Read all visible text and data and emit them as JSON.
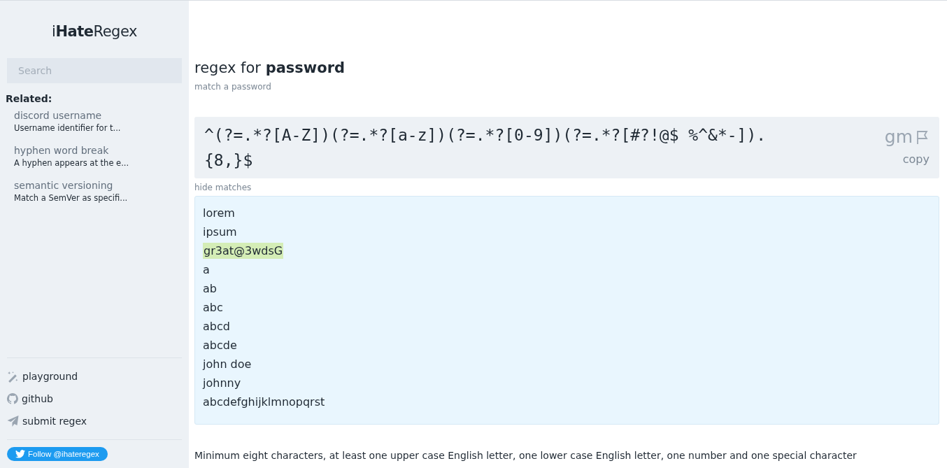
{
  "logo": {
    "prefix": "i",
    "bold": "Hate",
    "suffix": "Regex"
  },
  "search": {
    "placeholder": "Search"
  },
  "related": {
    "heading": "Related:",
    "items": [
      {
        "title": "discord username",
        "description": "Username identifier for t..."
      },
      {
        "title": "hyphen word break",
        "description": "A hyphen appears at the e..."
      },
      {
        "title": "semantic versioning",
        "description": "Match a SemVer as specifi..."
      }
    ]
  },
  "links": [
    {
      "kind": "playground",
      "label": "playground"
    },
    {
      "kind": "github",
      "label": "github"
    },
    {
      "kind": "submit",
      "label": "submit regex"
    }
  ],
  "follow_button": "Follow @ihateregex",
  "title": {
    "prefix": "regex for ",
    "subject": "password"
  },
  "subtitle": "match a password",
  "regex": {
    "pattern": "^(?=.*?[A-Z])(?=.*?[a-z])(?=.*?[0-9])(?=.*?[#?!@$ %^&*-]).{8,}$",
    "flags": "gm",
    "copy": "copy"
  },
  "toggle_matches": "hide matches",
  "samples": [
    {
      "text": "lorem",
      "matched": false
    },
    {
      "text": "ipsum",
      "matched": false
    },
    {
      "text": "gr3at@3wdsG",
      "matched": true
    },
    {
      "text": "a",
      "matched": false
    },
    {
      "text": "ab",
      "matched": false
    },
    {
      "text": "abc",
      "matched": false
    },
    {
      "text": "abcd",
      "matched": false
    },
    {
      "text": "abcde",
      "matched": false
    },
    {
      "text": "john doe",
      "matched": false
    },
    {
      "text": "johnny",
      "matched": false
    },
    {
      "text": "abcdefghijklmnopqrst",
      "matched": false
    }
  ],
  "description": "Minimum eight characters, at least one upper case English letter, one lower case English letter, one number and one special character"
}
